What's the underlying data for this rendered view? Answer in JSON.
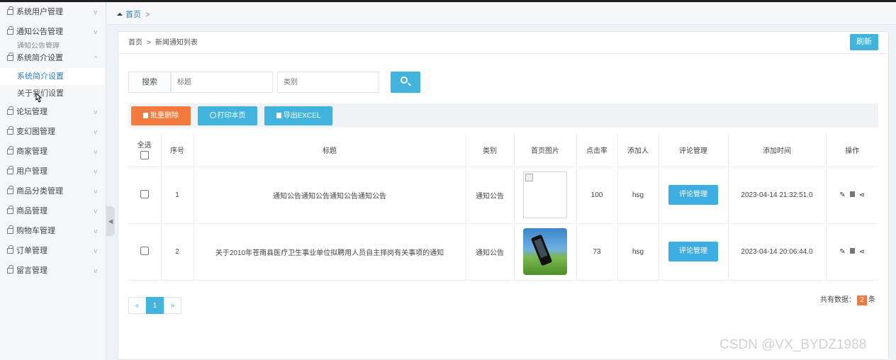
{
  "sidebar": {
    "menus": [
      {
        "label": "系统用户管理",
        "chevron": "v"
      },
      {
        "label": "通知公告管理",
        "chevron": "v"
      }
    ],
    "cut_sub_label": "通知公告管理",
    "open_menu": {
      "label": "系统简介设置",
      "chevron": "^"
    },
    "sub_items": [
      {
        "label": "系统简介设置",
        "active": true
      },
      {
        "label": "关于我们设置",
        "active": false
      }
    ],
    "menus_after": [
      {
        "label": "论坛管理",
        "chevron": "v"
      },
      {
        "label": "变幻图管理",
        "chevron": "v"
      },
      {
        "label": "商家管理",
        "chevron": "v"
      },
      {
        "label": "用户管理",
        "chevron": "v"
      },
      {
        "label": "商品分类管理",
        "chevron": "v"
      },
      {
        "label": "商品管理",
        "chevron": "v"
      },
      {
        "label": "购物车管理",
        "chevron": "v"
      },
      {
        "label": "订单管理",
        "chevron": "v"
      },
      {
        "label": "留言管理",
        "chevron": "v"
      }
    ],
    "collapse_arrow": "◀"
  },
  "tabbar": {
    "home": "首页",
    "sep": ">"
  },
  "breadcrumb": {
    "home": "首页",
    "gt": ">",
    "current": "新闻通知列表"
  },
  "refresh_label": "刷新",
  "search": {
    "label": "搜索",
    "title_placeholder": "标题",
    "type_placeholder": "类别"
  },
  "toolbar": {
    "batch_delete": "批量删除",
    "print": "打印本页",
    "export": "导出EXCEL"
  },
  "table": {
    "headers": {
      "select_all": "全选",
      "index": "序号",
      "title": "标题",
      "type": "类别",
      "image": "首页图片",
      "clicks": "点击率",
      "author": "添加人",
      "comments": "评论管理",
      "time": "添加时间",
      "actions": "操作"
    },
    "rows": [
      {
        "index": "1",
        "title": "通知公告通知公告通知公告通知公告",
        "type": "通知公告",
        "image": "broken",
        "clicks": "100",
        "author": "hsg",
        "comment_btn": "评论管理",
        "time": "2023-04-14 21:32:51.0"
      },
      {
        "index": "2",
        "title": "关于2010年苍南县医疗卫生事业单位拟聘用人员自主择岗有关事项的通知",
        "type": "通知公告",
        "image": "phone-photo",
        "clicks": "73",
        "author": "hsg",
        "comment_btn": "评论管理",
        "time": "2023-04-14 20:06:44.0"
      }
    ],
    "action_icons": [
      "edit-icon",
      "delete-icon",
      "share-icon"
    ]
  },
  "pager": {
    "prev": "«",
    "current": "1",
    "next": "»"
  },
  "total": {
    "prefix": "共有数据：",
    "count": "2",
    "suffix": "条"
  },
  "watermark": "CSDN @VX_BYDZ1988",
  "colors": {
    "accent": "#41b4dd",
    "danger": "#f27a3c",
    "link": "#2f7ec1"
  }
}
